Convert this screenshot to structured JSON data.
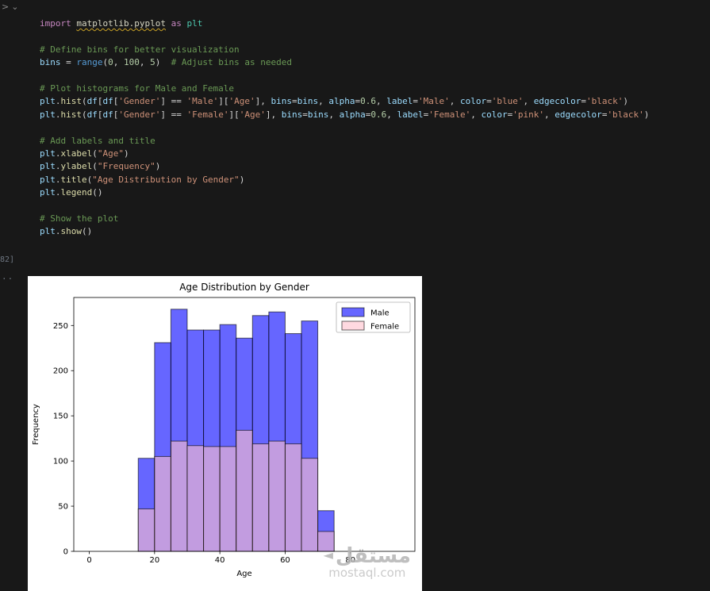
{
  "editor": {
    "gutter": {
      "fold_right": ">",
      "fold_down": "⌄",
      "execution_count": "82]",
      "drag_dots": ".."
    },
    "code": {
      "lines": [
        [
          {
            "c": "kw",
            "t": "import "
          },
          {
            "c": "mod",
            "t": "matplotlib.pyplot"
          },
          {
            "c": "kw",
            "t": " as "
          },
          {
            "c": "type",
            "t": "plt"
          }
        ],
        [],
        [
          {
            "c": "comment",
            "t": "# Define bins for better visualization"
          }
        ],
        [
          {
            "c": "var",
            "t": "bins"
          },
          {
            "c": "punct",
            "t": " = "
          },
          {
            "c": "builtin",
            "t": "range"
          },
          {
            "c": "punct",
            "t": "("
          },
          {
            "c": "num",
            "t": "0"
          },
          {
            "c": "punct",
            "t": ", "
          },
          {
            "c": "num",
            "t": "100"
          },
          {
            "c": "punct",
            "t": ", "
          },
          {
            "c": "num",
            "t": "5"
          },
          {
            "c": "punct",
            "t": ")  "
          },
          {
            "c": "comment",
            "t": "# Adjust bins as needed"
          }
        ],
        [],
        [
          {
            "c": "comment",
            "t": "# Plot histograms for Male and Female"
          }
        ],
        [
          {
            "c": "var",
            "t": "plt"
          },
          {
            "c": "punct",
            "t": "."
          },
          {
            "c": "func",
            "t": "hist"
          },
          {
            "c": "punct",
            "t": "("
          },
          {
            "c": "var",
            "t": "df"
          },
          {
            "c": "punct",
            "t": "["
          },
          {
            "c": "var",
            "t": "df"
          },
          {
            "c": "punct",
            "t": "["
          },
          {
            "c": "str",
            "t": "'Gender'"
          },
          {
            "c": "punct",
            "t": "] "
          },
          {
            "c": "op",
            "t": "=="
          },
          {
            "c": "punct",
            "t": " "
          },
          {
            "c": "str",
            "t": "'Male'"
          },
          {
            "c": "punct",
            "t": "]["
          },
          {
            "c": "str",
            "t": "'Age'"
          },
          {
            "c": "punct",
            "t": "], "
          },
          {
            "c": "param",
            "t": "bins"
          },
          {
            "c": "op",
            "t": "="
          },
          {
            "c": "var",
            "t": "bins"
          },
          {
            "c": "punct",
            "t": ", "
          },
          {
            "c": "param",
            "t": "alpha"
          },
          {
            "c": "op",
            "t": "="
          },
          {
            "c": "num",
            "t": "0.6"
          },
          {
            "c": "punct",
            "t": ", "
          },
          {
            "c": "param",
            "t": "label"
          },
          {
            "c": "op",
            "t": "="
          },
          {
            "c": "str",
            "t": "'Male'"
          },
          {
            "c": "punct",
            "t": ", "
          },
          {
            "c": "param",
            "t": "color"
          },
          {
            "c": "op",
            "t": "="
          },
          {
            "c": "str",
            "t": "'blue'"
          },
          {
            "c": "punct",
            "t": ", "
          },
          {
            "c": "param",
            "t": "edgecolor"
          },
          {
            "c": "op",
            "t": "="
          },
          {
            "c": "str",
            "t": "'black'"
          },
          {
            "c": "punct",
            "t": ")"
          }
        ],
        [
          {
            "c": "var",
            "t": "plt"
          },
          {
            "c": "punct",
            "t": "."
          },
          {
            "c": "func",
            "t": "hist"
          },
          {
            "c": "punct",
            "t": "("
          },
          {
            "c": "var",
            "t": "df"
          },
          {
            "c": "punct",
            "t": "["
          },
          {
            "c": "var",
            "t": "df"
          },
          {
            "c": "punct",
            "t": "["
          },
          {
            "c": "str",
            "t": "'Gender'"
          },
          {
            "c": "punct",
            "t": "] "
          },
          {
            "c": "op",
            "t": "=="
          },
          {
            "c": "punct",
            "t": " "
          },
          {
            "c": "str",
            "t": "'Female'"
          },
          {
            "c": "punct",
            "t": "]["
          },
          {
            "c": "str",
            "t": "'Age'"
          },
          {
            "c": "punct",
            "t": "], "
          },
          {
            "c": "param",
            "t": "bins"
          },
          {
            "c": "op",
            "t": "="
          },
          {
            "c": "var",
            "t": "bins"
          },
          {
            "c": "punct",
            "t": ", "
          },
          {
            "c": "param",
            "t": "alpha"
          },
          {
            "c": "op",
            "t": "="
          },
          {
            "c": "num",
            "t": "0.6"
          },
          {
            "c": "punct",
            "t": ", "
          },
          {
            "c": "param",
            "t": "label"
          },
          {
            "c": "op",
            "t": "="
          },
          {
            "c": "str",
            "t": "'Female'"
          },
          {
            "c": "punct",
            "t": ", "
          },
          {
            "c": "param",
            "t": "color"
          },
          {
            "c": "op",
            "t": "="
          },
          {
            "c": "str",
            "t": "'pink'"
          },
          {
            "c": "punct",
            "t": ", "
          },
          {
            "c": "param",
            "t": "edgecolor"
          },
          {
            "c": "op",
            "t": "="
          },
          {
            "c": "str",
            "t": "'black'"
          },
          {
            "c": "punct",
            "t": ")"
          }
        ],
        [],
        [
          {
            "c": "comment",
            "t": "# Add labels and title"
          }
        ],
        [
          {
            "c": "var",
            "t": "plt"
          },
          {
            "c": "punct",
            "t": "."
          },
          {
            "c": "func",
            "t": "xlabel"
          },
          {
            "c": "punct",
            "t": "("
          },
          {
            "c": "str",
            "t": "\"Age\""
          },
          {
            "c": "punct",
            "t": ")"
          }
        ],
        [
          {
            "c": "var",
            "t": "plt"
          },
          {
            "c": "punct",
            "t": "."
          },
          {
            "c": "func",
            "t": "ylabel"
          },
          {
            "c": "punct",
            "t": "("
          },
          {
            "c": "str",
            "t": "\"Frequency\""
          },
          {
            "c": "punct",
            "t": ")"
          }
        ],
        [
          {
            "c": "var",
            "t": "plt"
          },
          {
            "c": "punct",
            "t": "."
          },
          {
            "c": "func",
            "t": "title"
          },
          {
            "c": "punct",
            "t": "("
          },
          {
            "c": "str",
            "t": "\"Age Distribution by Gender\""
          },
          {
            "c": "punct",
            "t": ")"
          }
        ],
        [
          {
            "c": "var",
            "t": "plt"
          },
          {
            "c": "punct",
            "t": "."
          },
          {
            "c": "func",
            "t": "legend"
          },
          {
            "c": "punct",
            "t": "()"
          }
        ],
        [],
        [
          {
            "c": "comment",
            "t": "# Show the plot"
          }
        ],
        [
          {
            "c": "var",
            "t": "plt"
          },
          {
            "c": "punct",
            "t": "."
          },
          {
            "c": "func",
            "t": "show"
          },
          {
            "c": "punct",
            "t": "()"
          }
        ]
      ]
    }
  },
  "figure": {
    "watermark_logo": "◄",
    "watermark_primary": "مستقل",
    "watermark_secondary": "mostaql.com"
  },
  "chart_data": {
    "type": "bar",
    "subtype": "overlaid-histogram",
    "title": "Age Distribution by Gender",
    "xlabel": "Age",
    "ylabel": "Frequency",
    "bin_start": 15,
    "bin_width": 5,
    "xlim": [
      -4.75,
      99.75
    ],
    "ylim": [
      0,
      281
    ],
    "xticks": [
      0,
      20,
      40,
      60,
      80
    ],
    "yticks": [
      0,
      50,
      100,
      150,
      200,
      250
    ],
    "grid": false,
    "legend_position": "upper right",
    "series": [
      {
        "name": "Male",
        "color": "#0000ff",
        "alpha": 0.6,
        "edgecolor": "#000000",
        "values": [
          103,
          231,
          268,
          245,
          245,
          251,
          236,
          261,
          265,
          241,
          255,
          45
        ]
      },
      {
        "name": "Female",
        "color": "#ffc0cb",
        "alpha": 0.6,
        "edgecolor": "#000000",
        "values": [
          47,
          105,
          122,
          117,
          116,
          116,
          134,
          119,
          122,
          119,
          103,
          22
        ]
      }
    ]
  }
}
